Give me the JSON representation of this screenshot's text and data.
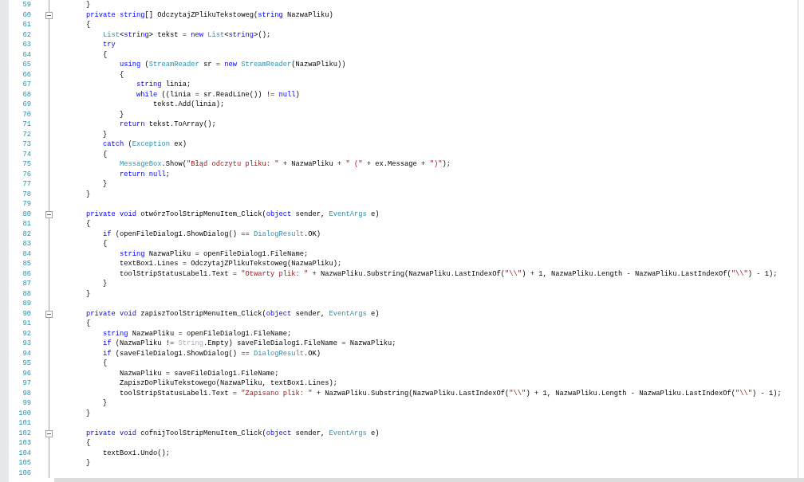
{
  "editor": {
    "lines": [
      {
        "number": "59",
        "tokens": [
          {
            "kind": "plain",
            "text": "        }"
          }
        ]
      },
      {
        "number": "60",
        "fold": {
          "expanded": true
        },
        "tokens": [
          {
            "kind": "keyword",
            "text": "        private "
          },
          {
            "kind": "keyword",
            "text": "string"
          },
          {
            "kind": "plain",
            "text": "[] OdczytajZPlikuTekstoweg("
          },
          {
            "kind": "keyword",
            "text": "string"
          },
          {
            "kind": "plain",
            "text": " NazwaPliku)"
          }
        ]
      },
      {
        "number": "61",
        "tokens": [
          {
            "kind": "plain",
            "text": "        {"
          }
        ]
      },
      {
        "number": "62",
        "tokens": [
          {
            "kind": "type",
            "text": "            List"
          },
          {
            "kind": "plain",
            "text": "<"
          },
          {
            "kind": "keyword",
            "text": "string"
          },
          {
            "kind": "plain",
            "text": "> tekst = "
          },
          {
            "kind": "keyword",
            "text": "new "
          },
          {
            "kind": "type",
            "text": "List"
          },
          {
            "kind": "plain",
            "text": "<"
          },
          {
            "kind": "keyword",
            "text": "string"
          },
          {
            "kind": "plain",
            "text": ">();"
          }
        ]
      },
      {
        "number": "63",
        "tokens": [
          {
            "kind": "keyword",
            "text": "            try"
          }
        ]
      },
      {
        "number": "64",
        "tokens": [
          {
            "kind": "plain",
            "text": "            {"
          }
        ]
      },
      {
        "number": "65",
        "tokens": [
          {
            "kind": "keyword",
            "text": "                using "
          },
          {
            "kind": "plain",
            "text": "("
          },
          {
            "kind": "type",
            "text": "StreamReader"
          },
          {
            "kind": "plain",
            "text": " sr = "
          },
          {
            "kind": "keyword",
            "text": "new "
          },
          {
            "kind": "type",
            "text": "StreamReader"
          },
          {
            "kind": "plain",
            "text": "(NazwaPliku))"
          }
        ]
      },
      {
        "number": "66",
        "tokens": [
          {
            "kind": "plain",
            "text": "                {"
          }
        ]
      },
      {
        "number": "67",
        "tokens": [
          {
            "kind": "keyword",
            "text": "                    string "
          },
          {
            "kind": "plain",
            "text": "linia;"
          }
        ]
      },
      {
        "number": "68",
        "tokens": [
          {
            "kind": "keyword",
            "text": "                    while "
          },
          {
            "kind": "plain",
            "text": "((linia = sr.ReadLine()) != "
          },
          {
            "kind": "keyword",
            "text": "null"
          },
          {
            "kind": "plain",
            "text": ")"
          }
        ]
      },
      {
        "number": "69",
        "tokens": [
          {
            "kind": "plain",
            "text": "                        tekst.Add(linia);"
          }
        ]
      },
      {
        "number": "70",
        "tokens": [
          {
            "kind": "plain",
            "text": "                }"
          }
        ]
      },
      {
        "number": "71",
        "tokens": [
          {
            "kind": "keyword",
            "text": "                return "
          },
          {
            "kind": "plain",
            "text": "tekst.ToArray();"
          }
        ]
      },
      {
        "number": "72",
        "tokens": [
          {
            "kind": "plain",
            "text": "            }"
          }
        ]
      },
      {
        "number": "73",
        "tokens": [
          {
            "kind": "keyword",
            "text": "            catch "
          },
          {
            "kind": "plain",
            "text": "("
          },
          {
            "kind": "type",
            "text": "Exception"
          },
          {
            "kind": "plain",
            "text": " ex)"
          }
        ]
      },
      {
        "number": "74",
        "tokens": [
          {
            "kind": "plain",
            "text": "            {"
          }
        ]
      },
      {
        "number": "75",
        "tokens": [
          {
            "kind": "type",
            "text": "                MessageBox"
          },
          {
            "kind": "plain",
            "text": ".Show("
          },
          {
            "kind": "string",
            "text": "\"Błąd odczytu pliku: \""
          },
          {
            "kind": "plain",
            "text": " + NazwaPliku + "
          },
          {
            "kind": "string",
            "text": "\" (\""
          },
          {
            "kind": "plain",
            "text": " + ex.Message + "
          },
          {
            "kind": "string",
            "text": "\")\""
          },
          {
            "kind": "plain",
            "text": ");"
          }
        ]
      },
      {
        "number": "76",
        "tokens": [
          {
            "kind": "keyword",
            "text": "                return null"
          },
          {
            "kind": "plain",
            "text": ";"
          }
        ]
      },
      {
        "number": "77",
        "tokens": [
          {
            "kind": "plain",
            "text": "            }"
          }
        ]
      },
      {
        "number": "78",
        "tokens": [
          {
            "kind": "plain",
            "text": "        }"
          }
        ]
      },
      {
        "number": "79"
      },
      {
        "number": "80",
        "fold": {
          "expanded": true
        },
        "tokens": [
          {
            "kind": "keyword",
            "text": "        private void "
          },
          {
            "kind": "plain",
            "text": "otwórzToolStripMenuItem_Click("
          },
          {
            "kind": "keyword",
            "text": "object"
          },
          {
            "kind": "plain",
            "text": " sender, "
          },
          {
            "kind": "type",
            "text": "EventArgs"
          },
          {
            "kind": "plain",
            "text": " e)"
          }
        ]
      },
      {
        "number": "81",
        "tokens": [
          {
            "kind": "plain",
            "text": "        {"
          }
        ]
      },
      {
        "number": "82",
        "tokens": [
          {
            "kind": "keyword",
            "text": "            if "
          },
          {
            "kind": "plain",
            "text": "(openFileDialog1.ShowDialog() == "
          },
          {
            "kind": "type",
            "text": "DialogResult"
          },
          {
            "kind": "plain",
            "text": ".OK)"
          }
        ]
      },
      {
        "number": "83",
        "tokens": [
          {
            "kind": "plain",
            "text": "            {"
          }
        ]
      },
      {
        "number": "84",
        "tokens": [
          {
            "kind": "keyword",
            "text": "                string "
          },
          {
            "kind": "plain",
            "text": "NazwaPliku = openFileDialog1.FileName;"
          }
        ]
      },
      {
        "number": "85",
        "tokens": [
          {
            "kind": "plain",
            "text": "                textBox1.Lines = OdczytajZPlikuTekstoweg(NazwaPliku);"
          }
        ]
      },
      {
        "number": "86",
        "tokens": [
          {
            "kind": "plain",
            "text": "                toolStripStatusLabel1.Text = "
          },
          {
            "kind": "string",
            "text": "\"Otwarty plik: \""
          },
          {
            "kind": "plain",
            "text": " + NazwaPliku.Substring(NazwaPliku.LastIndexOf("
          },
          {
            "kind": "string",
            "text": "\"\\\\\""
          },
          {
            "kind": "plain",
            "text": ") + 1, NazwaPliku.Length - NazwaPliku.LastIndexOf("
          },
          {
            "kind": "string",
            "text": "\"\\\\\""
          },
          {
            "kind": "plain",
            "text": ") - 1);"
          }
        ]
      },
      {
        "number": "87",
        "tokens": [
          {
            "kind": "plain",
            "text": "            }"
          }
        ]
      },
      {
        "number": "88",
        "tokens": [
          {
            "kind": "plain",
            "text": "        }"
          }
        ]
      },
      {
        "number": "89"
      },
      {
        "number": "90",
        "fold": {
          "expanded": true
        },
        "tokens": [
          {
            "kind": "keyword",
            "text": "        private void "
          },
          {
            "kind": "plain",
            "text": "zapiszToolStripMenuItem_Click("
          },
          {
            "kind": "keyword",
            "text": "object"
          },
          {
            "kind": "plain",
            "text": " sender, "
          },
          {
            "kind": "type",
            "text": "EventArgs"
          },
          {
            "kind": "plain",
            "text": " e)"
          }
        ]
      },
      {
        "number": "91",
        "tokens": [
          {
            "kind": "plain",
            "text": "        {"
          }
        ]
      },
      {
        "number": "92",
        "tokens": [
          {
            "kind": "keyword",
            "text": "            string "
          },
          {
            "kind": "plain",
            "text": "NazwaPliku = openFileDialog1.FileName;"
          }
        ]
      },
      {
        "number": "93",
        "tokens": [
          {
            "kind": "keyword",
            "text": "            if "
          },
          {
            "kind": "plain",
            "text": "(NazwaPliku != "
          },
          {
            "kind": "muted",
            "text": "String"
          },
          {
            "kind": "plain",
            "text": ".Empty) saveFileDialog1.FileName = NazwaPliku;"
          }
        ]
      },
      {
        "number": "94",
        "tokens": [
          {
            "kind": "keyword",
            "text": "            if "
          },
          {
            "kind": "plain",
            "text": "(saveFileDialog1.ShowDialog() == "
          },
          {
            "kind": "type",
            "text": "DialogResult"
          },
          {
            "kind": "plain",
            "text": ".OK)"
          }
        ]
      },
      {
        "number": "95",
        "tokens": [
          {
            "kind": "plain",
            "text": "            {"
          }
        ]
      },
      {
        "number": "96",
        "tokens": [
          {
            "kind": "plain",
            "text": "                NazwaPliku = saveFileDialog1.FileName;"
          }
        ]
      },
      {
        "number": "97",
        "tokens": [
          {
            "kind": "plain",
            "text": "                ZapiszDoPlikuTekstowego(NazwaPliku, textBox1.Lines);"
          }
        ]
      },
      {
        "number": "98",
        "tokens": [
          {
            "kind": "plain",
            "text": "                toolStripStatusLabel1.Text = "
          },
          {
            "kind": "string",
            "text": "\"Zapisano plik: \""
          },
          {
            "kind": "plain",
            "text": " + NazwaPliku.Substring(NazwaPliku.LastIndexOf("
          },
          {
            "kind": "string",
            "text": "\"\\\\\""
          },
          {
            "kind": "plain",
            "text": ") + 1, NazwaPliku.Length - NazwaPliku.LastIndexOf("
          },
          {
            "kind": "string",
            "text": "\"\\\\\""
          },
          {
            "kind": "plain",
            "text": ") - 1);"
          }
        ]
      },
      {
        "number": "99",
        "tokens": [
          {
            "kind": "plain",
            "text": "            }"
          }
        ]
      },
      {
        "number": "100",
        "tokens": [
          {
            "kind": "plain",
            "text": "        }"
          }
        ]
      },
      {
        "number": "101"
      },
      {
        "number": "102",
        "fold": {
          "expanded": true
        },
        "tokens": [
          {
            "kind": "keyword",
            "text": "        private void "
          },
          {
            "kind": "plain",
            "text": "cofnijToolStripMenuItem_Click("
          },
          {
            "kind": "keyword",
            "text": "object"
          },
          {
            "kind": "plain",
            "text": " sender, "
          },
          {
            "kind": "type",
            "text": "EventArgs"
          },
          {
            "kind": "plain",
            "text": " e)"
          }
        ]
      },
      {
        "number": "103",
        "tokens": [
          {
            "kind": "plain",
            "text": "        {"
          }
        ]
      },
      {
        "number": "104",
        "tokens": [
          {
            "kind": "plain",
            "text": "            textBox1.Undo();"
          }
        ]
      },
      {
        "number": "105",
        "tokens": [
          {
            "kind": "plain",
            "text": "        }"
          }
        ]
      },
      {
        "number": "106"
      }
    ]
  }
}
